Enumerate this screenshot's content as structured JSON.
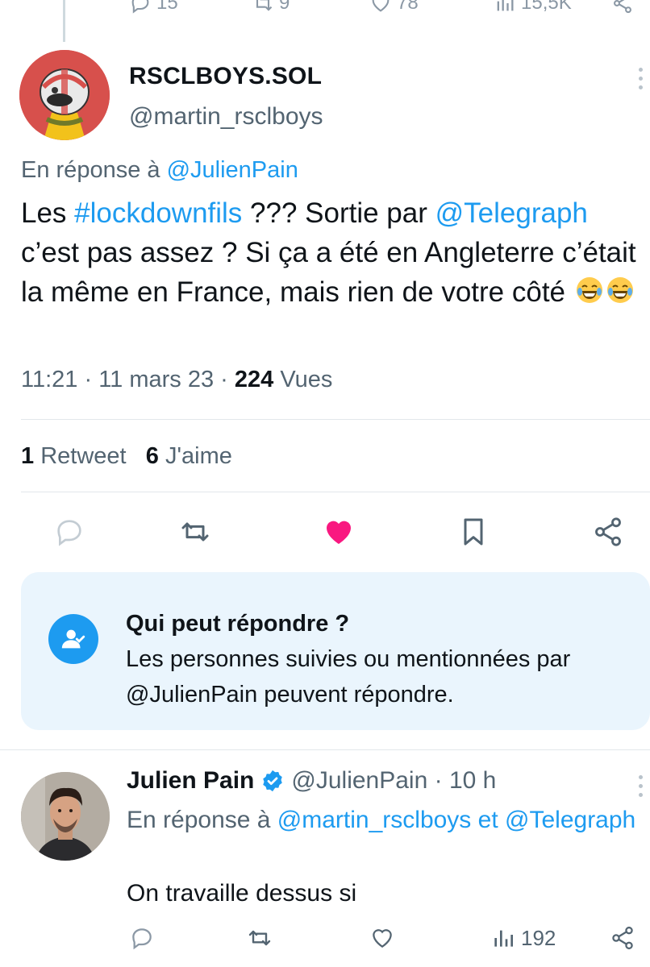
{
  "top_partial_tweet": {
    "stats": [
      "15",
      "9",
      "78",
      "15,5K"
    ]
  },
  "tweet": {
    "display_name": "RSCLBOYS.SOL",
    "handle": "@martin_rsclboys",
    "reply_prefix": "En réponse à ",
    "reply_handle": "@JulienPain",
    "text_1": "Les ",
    "hashtag": "#lockdownfils",
    "text_2": " ??? Sortie par ",
    "mention": "@Telegraph",
    "text_3": " c’est pas assez ? Si ça a été en Angleterre c’était la même en France, mais rien de votre côté",
    "emoji": "face-with-tears-of-joy x2",
    "time": "11:21",
    "date": "11 mars 23",
    "views_count": "224",
    "views_label": "Vues",
    "retweet_count": "1",
    "retweet_label": "Retweet",
    "like_count": "6",
    "like_label": "J'aime",
    "liked_color": "#f91880"
  },
  "who_can_reply": {
    "title": "Qui peut répondre ?",
    "description": "Les personnes suivies ou mentionnées par @JulienPain peuvent répondre."
  },
  "reply": {
    "display_name": "Julien Pain",
    "handle": "@JulienPain",
    "time_ago": "10 h",
    "reply_prefix": "En réponse à ",
    "reply_handle_1": "@martin_rsclboys",
    "reply_and": " et ",
    "reply_handle_2": "@Telegraph",
    "text": "On travaille dessus si",
    "views": "192"
  },
  "colors": {
    "accent": "#1d9bf0",
    "secondary_text": "#536471",
    "like": "#f91880"
  }
}
